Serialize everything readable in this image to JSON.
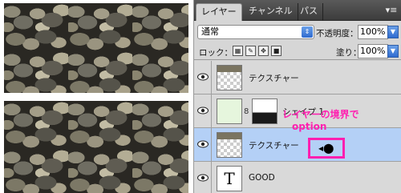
{
  "tabs": [
    "レイヤー",
    "チャンネル",
    "パス"
  ],
  "panel_menu_icon": "panel-menu-icon",
  "blend_mode": "通常",
  "opacity_label": "不透明度：",
  "opacity_value": "100%",
  "lock_label": "ロック：",
  "fill_label": "塗り：",
  "fill_value": "100%",
  "layers": [
    {
      "name": "テクスチャー",
      "thumb": "texture"
    },
    {
      "name": "シェイプ 1",
      "thumb": "shape"
    },
    {
      "name": "テクスチャー",
      "thumb": "texture",
      "selected": true
    },
    {
      "name": "GOOD",
      "thumb": "text",
      "thumb_glyph": "T"
    }
  ],
  "annotation": {
    "line1": "レイヤーの境界で",
    "line2": "option"
  },
  "colors": {
    "accent": "#ff1fb0",
    "selection": "#b4d0f6"
  }
}
